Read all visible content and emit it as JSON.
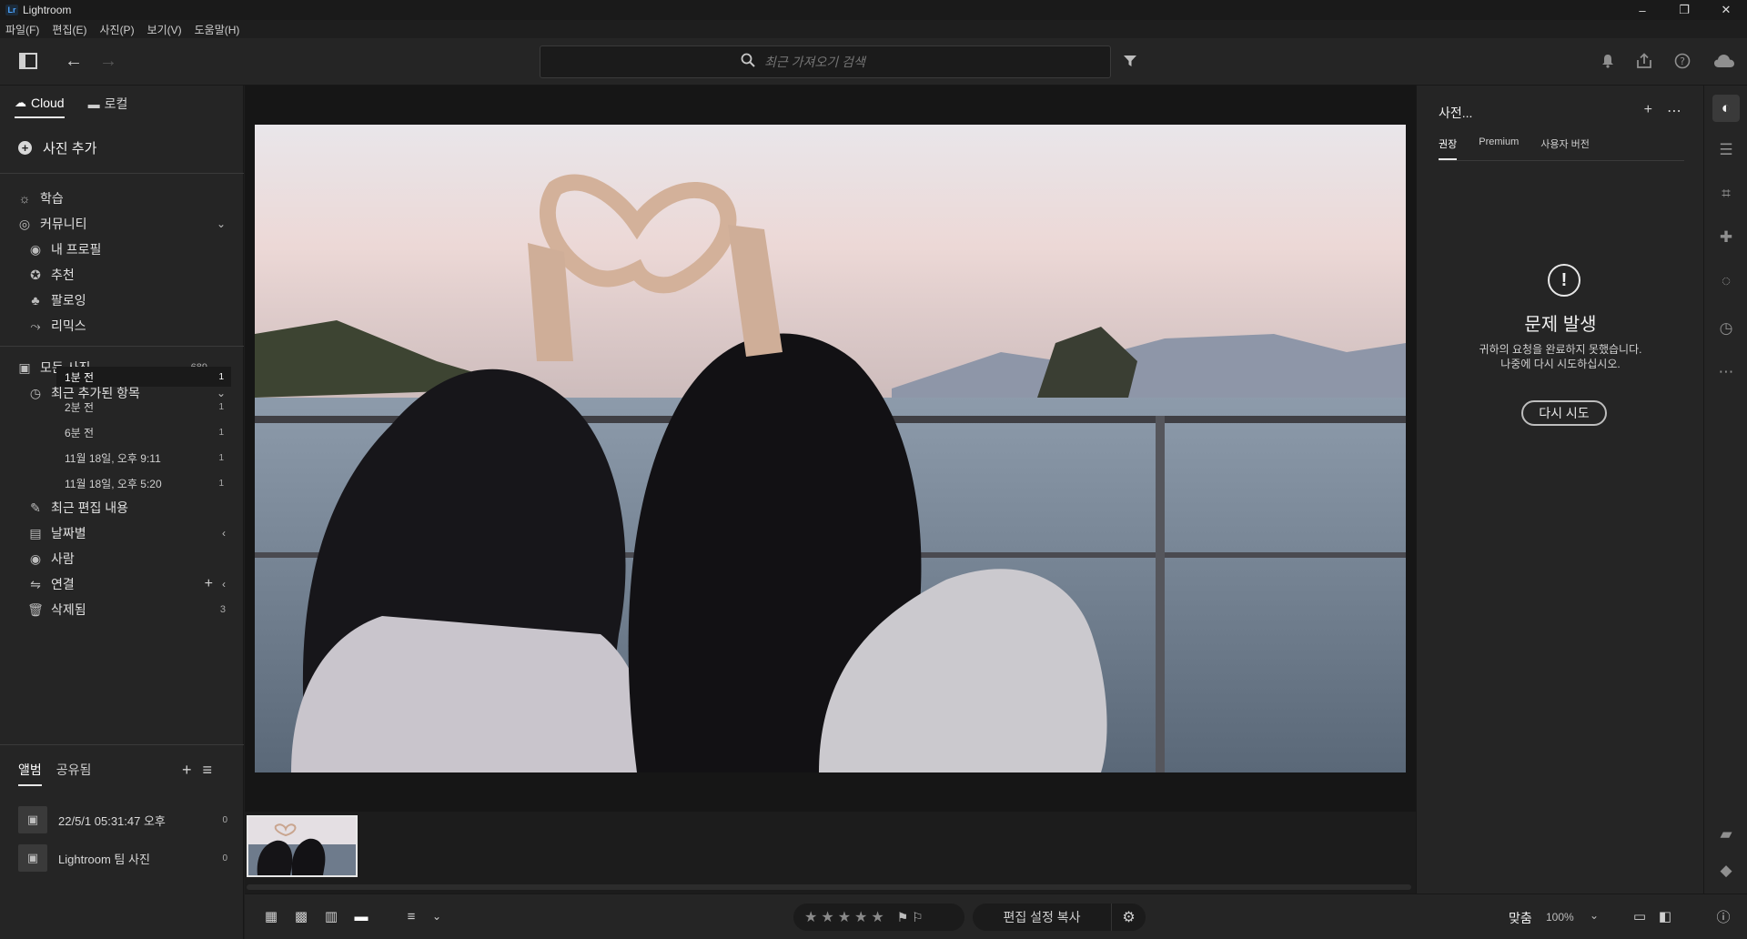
{
  "app": {
    "title": "Lightroom",
    "logo": "Lr"
  },
  "window_controls": {
    "minimize": "–",
    "restore": "❐",
    "close": "✕"
  },
  "menu": [
    "파일(F)",
    "편집(E)",
    "사진(P)",
    "보기(V)",
    "도움말(H)"
  ],
  "search": {
    "placeholder": "최근 가져오기 검색"
  },
  "left": {
    "tabs": {
      "cloud": "Cloud",
      "local": "로컬"
    },
    "add_photo": "사진 추가",
    "learn": "학습",
    "community": {
      "label": "커뮤니티",
      "items": [
        "내 프로필",
        "추천",
        "팔로잉",
        "리믹스"
      ]
    },
    "all_photos": {
      "label": "모든 사진",
      "count": "689"
    },
    "recent_added": {
      "label": "최근 추가된 항목",
      "items": [
        {
          "label": "1분 전",
          "count": "1"
        },
        {
          "label": "2분 전",
          "count": "1"
        },
        {
          "label": "6분 전",
          "count": "1"
        },
        {
          "label": "11월 18일, 오후 9:11",
          "count": "1"
        },
        {
          "label": "11월 18일, 오후 5:20",
          "count": "1"
        }
      ]
    },
    "recent_edits": "최근 편집 내용",
    "by_date": "날짜별",
    "people": "사람",
    "connections": "연결",
    "deleted": {
      "label": "삭제됨",
      "count": "3"
    },
    "album_tabs": {
      "albums": "앨범",
      "shared": "공유됨"
    },
    "albums": [
      {
        "label": "22/5/1 05:31:47 오후",
        "count": "0"
      },
      {
        "label": "Lightroom 팀 사진",
        "count": "0"
      }
    ]
  },
  "right": {
    "title": "사전...",
    "tabs": [
      "권장",
      "Premium",
      "사용자 버전"
    ],
    "error": {
      "title": "문제 발생",
      "line1": "귀하의 요청을 완료하지 못했습니다.",
      "line2": "나중에 다시 시도하십시오.",
      "retry": "다시 시도"
    }
  },
  "bottom": {
    "copy_settings": "편집 설정 복사",
    "fit": "맞춤",
    "zoom": "100%"
  }
}
